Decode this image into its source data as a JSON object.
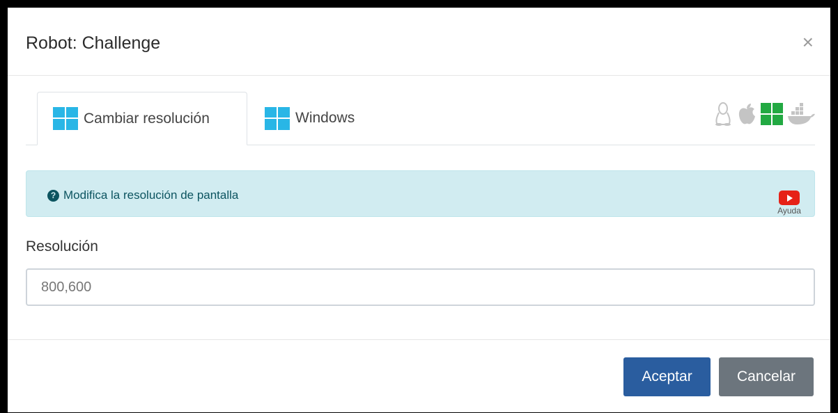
{
  "modal": {
    "title": "Robot: Challenge",
    "close_label": "×"
  },
  "tabs": [
    {
      "label": "Cambiar resolución",
      "icon": "windows-icon",
      "active": true
    },
    {
      "label": "Windows",
      "icon": "windows-icon",
      "active": false
    }
  ],
  "os_icons": [
    "linux-icon",
    "apple-icon",
    "windows-icon",
    "docker-icon"
  ],
  "colors": {
    "windows_blue": "#29b6e6",
    "windows_green": "#22a942",
    "gray_icon": "#c4c4c4",
    "primary": "#2a5d9f",
    "secondary": "#6c757d",
    "alert_bg": "#d1ecf1",
    "youtube_red": "#e62117"
  },
  "alert": {
    "text": "Modifica la resolución de pantalla",
    "help_label": "Ayuda"
  },
  "form": {
    "label": "Resolución",
    "value": "800,600"
  },
  "footer": {
    "accept_label": "Aceptar",
    "cancel_label": "Cancelar"
  }
}
